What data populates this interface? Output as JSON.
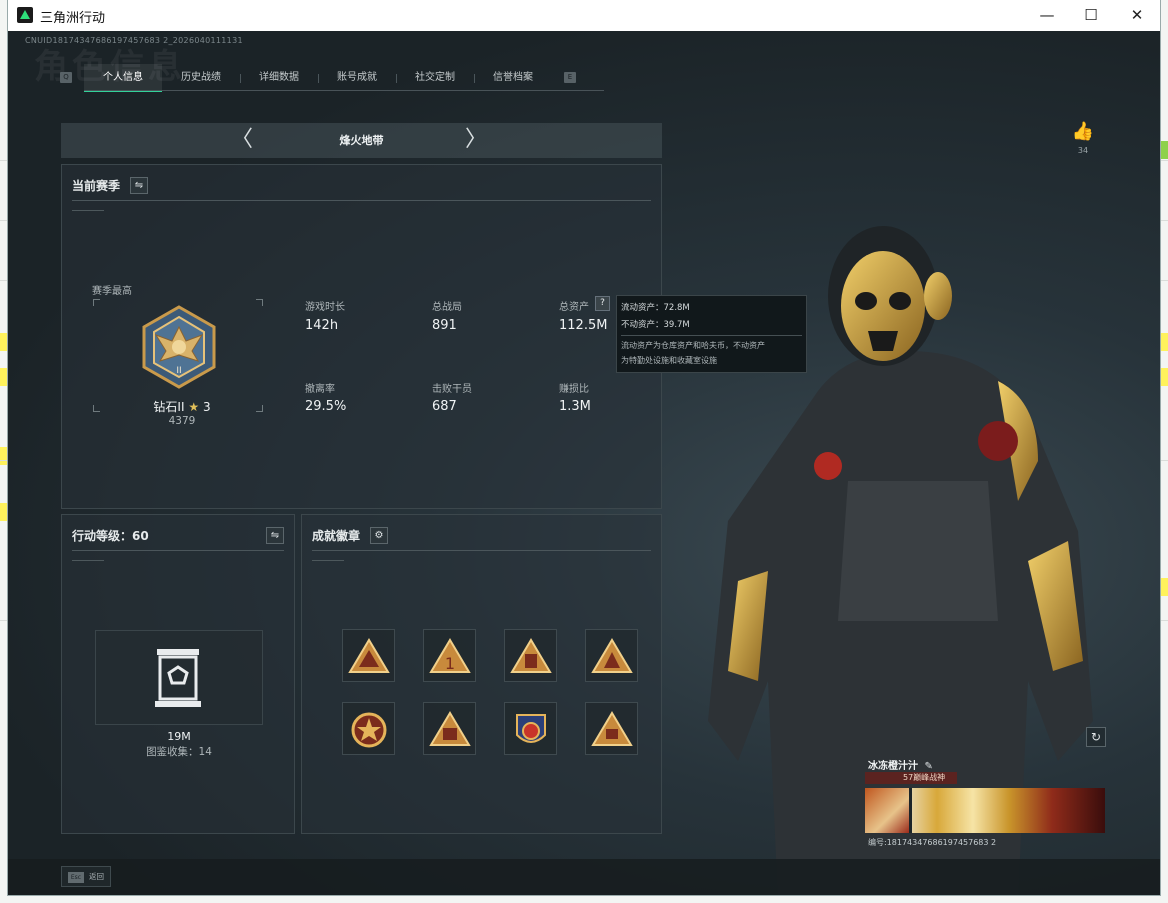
{
  "window": {
    "title": "三角洲行动",
    "controls": {
      "minimize": "—",
      "maximize": "☐",
      "close": "✕"
    }
  },
  "game": {
    "uid_text": "CNUID18174347686197457683 2_2026040111131",
    "ghost_title": "角色信息",
    "tabs": {
      "prev_key": "Q",
      "next_key": "E",
      "items": [
        {
          "label": "个人信息",
          "active": true
        },
        {
          "label": "历史战绩",
          "active": false
        },
        {
          "label": "详细数据",
          "active": false
        },
        {
          "label": "账号成就",
          "active": false
        },
        {
          "label": "社交定制",
          "active": false
        },
        {
          "label": "信誉档案",
          "active": false
        }
      ]
    },
    "mode_selector": {
      "prev": "〈",
      "label": "烽火地带",
      "next": "〉"
    },
    "season_panel": {
      "title": "当前赛季",
      "swap_icon": "⇋",
      "season_high_label": "赛季最高",
      "rank_name": "钻石II",
      "rank_stars": "3",
      "rank_points": "4379",
      "stats": [
        {
          "label": "游戏时长",
          "value": "142h"
        },
        {
          "label": "总战局",
          "value": "891"
        },
        {
          "label": "总资产",
          "value": "112.5M"
        },
        {
          "label": "撤离率",
          "value": "29.5%"
        },
        {
          "label": "击败干员",
          "value": "687"
        },
        {
          "label": "赚损比",
          "value": "1.3M"
        }
      ],
      "help_icon": "?"
    },
    "asset_tooltip": {
      "line1": "流动资产：72.8M",
      "line2": "不动资产：39.7M",
      "note1": "流动资产为仓库资产和哈夫币，不动资产",
      "note2": "为特勤处设施和收藏室设施"
    },
    "level_panel": {
      "title": "行动等级：60",
      "swap_icon": "⇋",
      "collection_value": "19M",
      "collection_label": "图鉴收集：14"
    },
    "badges_panel": {
      "title": "成就徽章",
      "settings_icon": "⚙",
      "badges": [
        "badge-1",
        "badge-2",
        "badge-3",
        "badge-4",
        "badge-5",
        "badge-6",
        "badge-7",
        "badge-8"
      ]
    },
    "like": {
      "icon": "👍",
      "count": "34"
    },
    "player": {
      "name": "冰冻橙汁汁",
      "edit_icon": "✎",
      "title_tag": "57巅峰战神",
      "id_text": "编号:18174347686197457683 2"
    },
    "bottom": {
      "esc_key": "Esc",
      "esc_label": "返回"
    },
    "colors": {
      "accent": "#33d29a",
      "gold": "#d8a83a",
      "panel": "#283238"
    }
  }
}
